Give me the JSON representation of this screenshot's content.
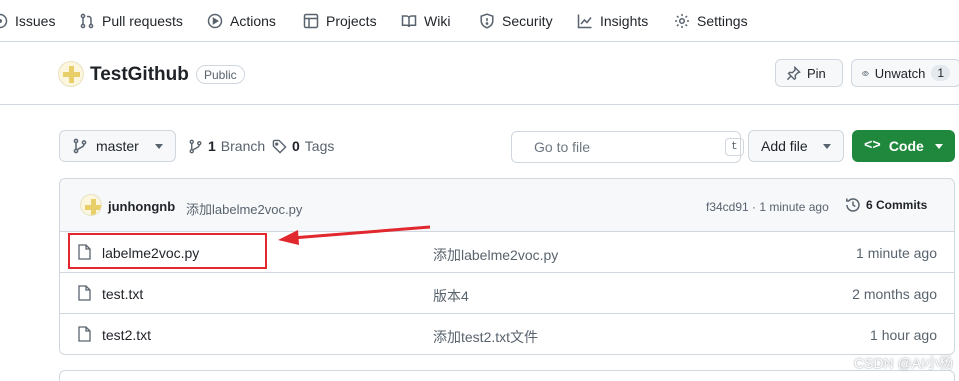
{
  "nav": {
    "issues": "Issues",
    "pull_requests": "Pull requests",
    "actions": "Actions",
    "projects": "Projects",
    "wiki": "Wiki",
    "security": "Security",
    "insights": "Insights",
    "settings": "Settings"
  },
  "repo": {
    "name": "TestGithub",
    "visibility": "Public",
    "pin_label": "Pin",
    "unwatch_label": "Unwatch",
    "watch_count": "1"
  },
  "toolbar": {
    "branch": "master",
    "branch_count": "1",
    "branch_label": "Branch",
    "tag_count": "0",
    "tag_label": "Tags",
    "search_placeholder": "Go to file",
    "search_shortcut": "t",
    "add_file_label": "Add file",
    "code_label": "Code"
  },
  "commit": {
    "author": "junhongnb",
    "message": "添加labelme2voc.py",
    "hash_time": "f34cd91 · 1 minute ago",
    "commits_count": "6 Commits"
  },
  "files": [
    {
      "name": "labelme2voc.py",
      "commit": "添加labelme2voc.py",
      "age": "1 minute ago"
    },
    {
      "name": "test.txt",
      "commit": "版本4",
      "age": "2 months ago"
    },
    {
      "name": "test2.txt",
      "commit": "添加test2.txt文件",
      "age": "1 hour ago"
    }
  ],
  "annotation": {
    "highlight_color": "#e0282e"
  },
  "watermark": "CSDN @AI小杨",
  "colors": {
    "accent_green": "#1f883d",
    "border": "#d0d7de",
    "muted_text": "#59636e"
  }
}
